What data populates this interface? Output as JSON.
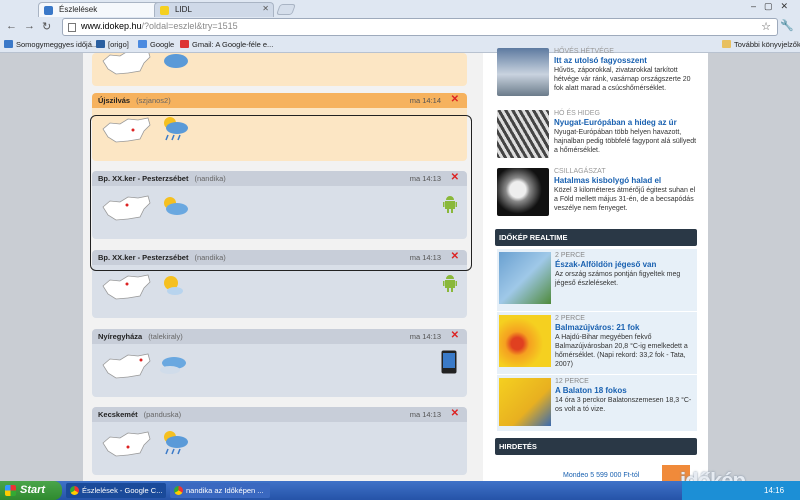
{
  "browser": {
    "tabs": [
      {
        "label": "Észlelések",
        "active": true
      },
      {
        "label": "LIDL",
        "active": false
      }
    ],
    "url_host": "www.idokep.hu",
    "url_path": "/?oldal=eszlel&try=1515",
    "bookmarks": [
      {
        "label": "Somogymeggyes időjá..."
      },
      {
        "label": "[origo]"
      },
      {
        "label": "Google"
      },
      {
        "label": "Gmail: A Google-féle e..."
      }
    ],
    "other_bookmarks": "További könyvjelzők"
  },
  "feed": [
    {
      "place": "Újszilvás",
      "user": "(szjanos2)",
      "time": "ma 14:14",
      "style": "orange",
      "weather": "partly-cloudy-rain",
      "device": ""
    },
    {
      "place": "Bp. XX.ker - Pesterzsébet",
      "user": "(nandika)",
      "time": "ma 14:13",
      "style": "blue",
      "weather": "partly-cloudy",
      "device": "android"
    },
    {
      "place": "Bp. XX.ker - Pesterzsébet",
      "user": "(nandika)",
      "time": "ma 14:13",
      "style": "blue",
      "weather": "sunny-cloud",
      "device": "android"
    },
    {
      "place": "Nyíregyháza",
      "user": "(talekiraly)",
      "time": "ma 14:13",
      "style": "blue",
      "weather": "cloudy",
      "device": "phone"
    },
    {
      "place": "Kecskemét",
      "user": "(panduska)",
      "time": "ma 14:13",
      "style": "blue",
      "weather": "partly-cloudy-rain",
      "device": ""
    }
  ],
  "news": [
    {
      "category": "HŐVÉS HÉTVÉGE",
      "title": "Itt az utolsó fagyosszent",
      "text": "Hűvös, záporokkal, zivatarokkal tarkított hétvége vár ránk, vasárnap országszerte 20 fok alatt marad a csúcshőmérséklet."
    },
    {
      "category": "HÓ ÉS HIDEG",
      "title": "Nyugat-Európában a hideg az úr",
      "text": "Nyugat-Európában több helyen havazott, hajnalban pedig többfelé fagypont alá süllyedt a hőmérséklet."
    },
    {
      "category": "CSILLAGÁSZAT",
      "title": "Hatalmas kisbolygó halad el",
      "text": "Közel 3 kilométeres átmérőjű égitest suhan el a Föld mellett május 31-én, de a becsapódás veszélye nem fenyeget."
    }
  ],
  "realtime_heading": "IDŐKÉP REALTIME",
  "realtime": [
    {
      "category": "2 PERCE",
      "title": "Észak-Alföldön jégeső van",
      "text": "Az ország számos pontján figyeltek meg jégeső észleléseket."
    },
    {
      "category": "2 PERCE",
      "title": "Balmazújváros: 21 fok",
      "text": "A Hajdú-Bihar megyében fekvő Balmazújvárosban 20,8 °C-ig emelkedett a hőmérséklet. (Napi rekord: 33,2 fok - Tata, 2007)"
    },
    {
      "category": "12 PERCE",
      "title": "A Balaton 18 fokos",
      "text": "14 óra 3 perckor Balatonszemesen 18,3 °C-os volt a tó vize."
    }
  ],
  "ad_heading": "HIRDETÉS",
  "ad_text": "Mondeo 5 599 000 Ft-tól",
  "site_logo": "időkép",
  "taskbar": {
    "start": "Start",
    "tasks": [
      "Észlelések - Google C...",
      "nandika az Időképen ..."
    ],
    "clock": "14:16"
  }
}
